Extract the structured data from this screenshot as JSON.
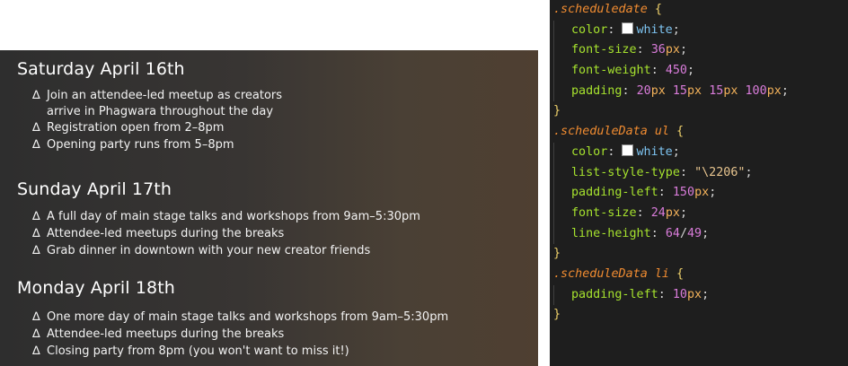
{
  "schedule": {
    "days": [
      {
        "title": "Saturday April 16th",
        "items": [
          "Join an attendee-led meetup as creators",
          "Registration open from 2–8pm",
          "Opening party runs from 5–8pm"
        ],
        "continuation": "arrive in Phagwara throughout the day"
      },
      {
        "title": "Sunday April 17th",
        "items": [
          "A full day of main stage talks and workshops from 9am–5:30pm",
          "Attendee-led meetups during the breaks",
          "Grab dinner in downtown with your new creator friends"
        ]
      },
      {
        "title": "Monday April 18th",
        "items": [
          "One more day of main stage talks and workshops from 9am–5:30pm",
          "Attendee-led meetups during the breaks",
          "Closing party from 8pm (you won't want to miss it!)"
        ]
      }
    ],
    "bullet": "∆"
  },
  "code": {
    "sel1": ".scheduledate",
    "sel2": ".scheduleData ul",
    "sel3": ".scheduleData li",
    "open": " {",
    "close": "}",
    "color_prop": "color",
    "white": "white",
    "font_size_prop": "font-size",
    "font_weight_prop": "font-weight",
    "padding_prop": "padding",
    "list_style_prop": "list-style-type",
    "padding_left_prop": "padding-left",
    "line_height_prop": "line-height",
    "v36": "36",
    "px": "px",
    "v450": "450",
    "v20": "20",
    "v15a": "15",
    "v15b": "15",
    "v100": "100",
    "liststr": "\"\\2206\"",
    "v150": "150",
    "v24": "24",
    "v64": "64",
    "slash": "/",
    "v49": "49",
    "v10": "10",
    "colon": ": ",
    "semi": ";",
    "sp": " "
  },
  "colors": {
    "selector": "#f18c31",
    "property": "#a6e22e",
    "number": "#d97cda",
    "unit": "#f2b15a",
    "editor_bg": "#1e1e1e"
  }
}
